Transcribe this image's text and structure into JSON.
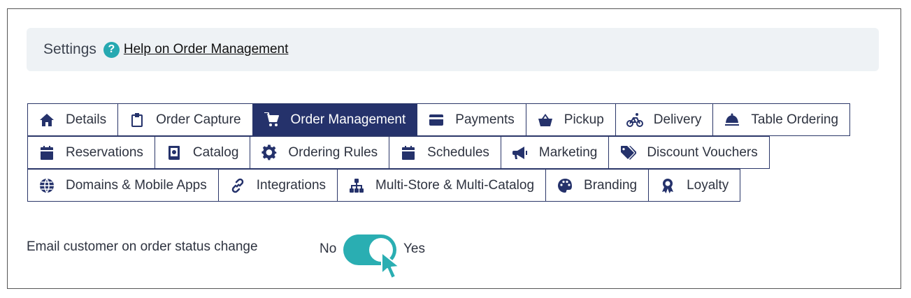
{
  "header": {
    "title": "Settings",
    "help_badge": "?",
    "help_link": "Help on Order Management"
  },
  "tabs": [
    [
      {
        "label": "Details",
        "icon": "home-icon"
      },
      {
        "label": "Order Capture",
        "icon": "clipboard-icon"
      },
      {
        "label": "Order Management",
        "icon": "cart-icon",
        "active": true
      },
      {
        "label": "Payments",
        "icon": "credit-card-icon"
      },
      {
        "label": "Pickup",
        "icon": "basket-icon"
      },
      {
        "label": "Delivery",
        "icon": "bicycle-icon"
      },
      {
        "label": "Table Ordering",
        "icon": "cloche-icon"
      }
    ],
    [
      {
        "label": "Reservations",
        "icon": "calendar-icon"
      },
      {
        "label": "Catalog",
        "icon": "book-icon"
      },
      {
        "label": "Ordering Rules",
        "icon": "gear-icon"
      },
      {
        "label": "Schedules",
        "icon": "calendar-icon"
      },
      {
        "label": "Marketing",
        "icon": "megaphone-icon"
      },
      {
        "label": "Discount Vouchers",
        "icon": "tags-icon"
      }
    ],
    [
      {
        "label": "Domains & Mobile Apps",
        "icon": "globe-icon"
      },
      {
        "label": "Integrations",
        "icon": "link-icon"
      },
      {
        "label": "Multi-Store & Multi-Catalog",
        "icon": "sitemap-icon"
      },
      {
        "label": "Branding",
        "icon": "palette-icon"
      },
      {
        "label": "Loyalty",
        "icon": "award-icon"
      }
    ]
  ],
  "setting": {
    "label": "Email customer on order status change",
    "off_label": "No",
    "on_label": "Yes",
    "value": "Yes"
  },
  "colors": {
    "active_tab": "#25326b",
    "toggle_on": "#2aaeb2",
    "help_badge": "#26a9b1",
    "header_bg": "#eef2f5"
  }
}
